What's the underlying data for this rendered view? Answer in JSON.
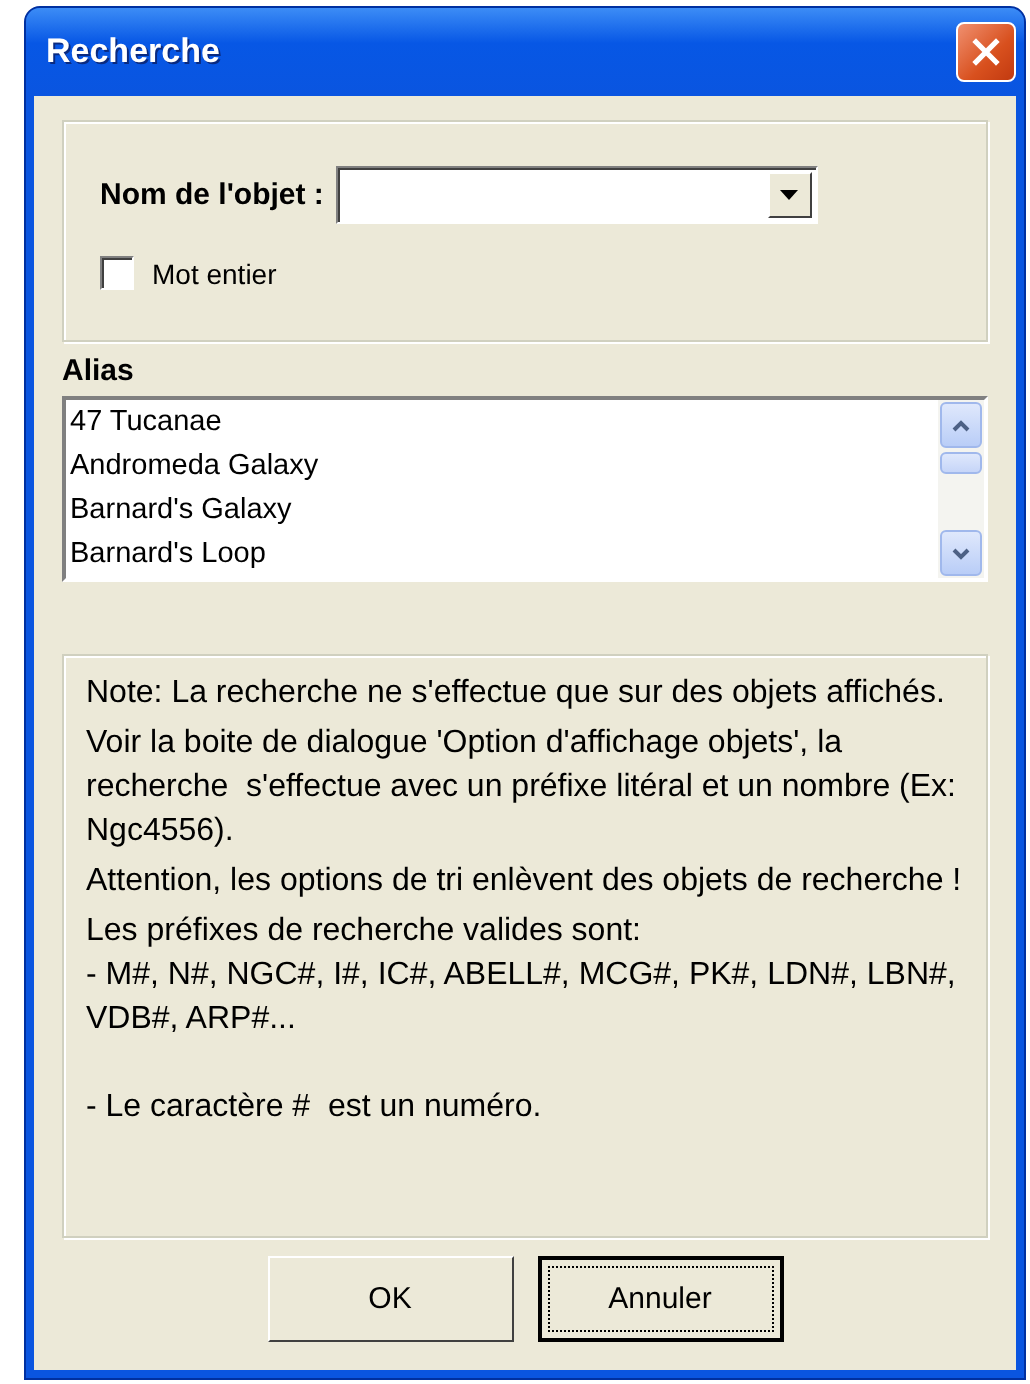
{
  "window": {
    "title": "Recherche"
  },
  "object_name": {
    "label": "Nom de l'objet :"
  },
  "whole_word": {
    "label": "Mot entier",
    "checked": false
  },
  "alias": {
    "label": "Alias",
    "items": [
      {
        "text": "47 Tucanae",
        "selected": false
      },
      {
        "text": "Andromeda Galaxy",
        "selected": false
      },
      {
        "text": "Barnard's Galaxy",
        "selected": false
      },
      {
        "text": "Barnard's Loop",
        "selected": false
      }
    ]
  },
  "note": [
    "Note: La recherche ne s'effectue que sur des objets affichés.",
    "Voir la boite de dialogue 'Option d'affichage objets', la recherche  s'effectue avec un préfixe litéral et un nombre (Ex: Ngc4556).",
    "Attention, les options de tri enlèvent des objets de recherche !",
    "Les préfixes de recherche valides sont:\n- M#, N#, NGC#, I#, IC#, ABELL#, MCG#, PK#, LDN#, LBN#, VDB#, ARP#...\n\n- Le caractère #  est un numéro."
  ],
  "buttons": [
    {
      "label": "OK",
      "focused": false
    },
    {
      "label": "Annuler",
      "focused": true
    }
  ]
}
